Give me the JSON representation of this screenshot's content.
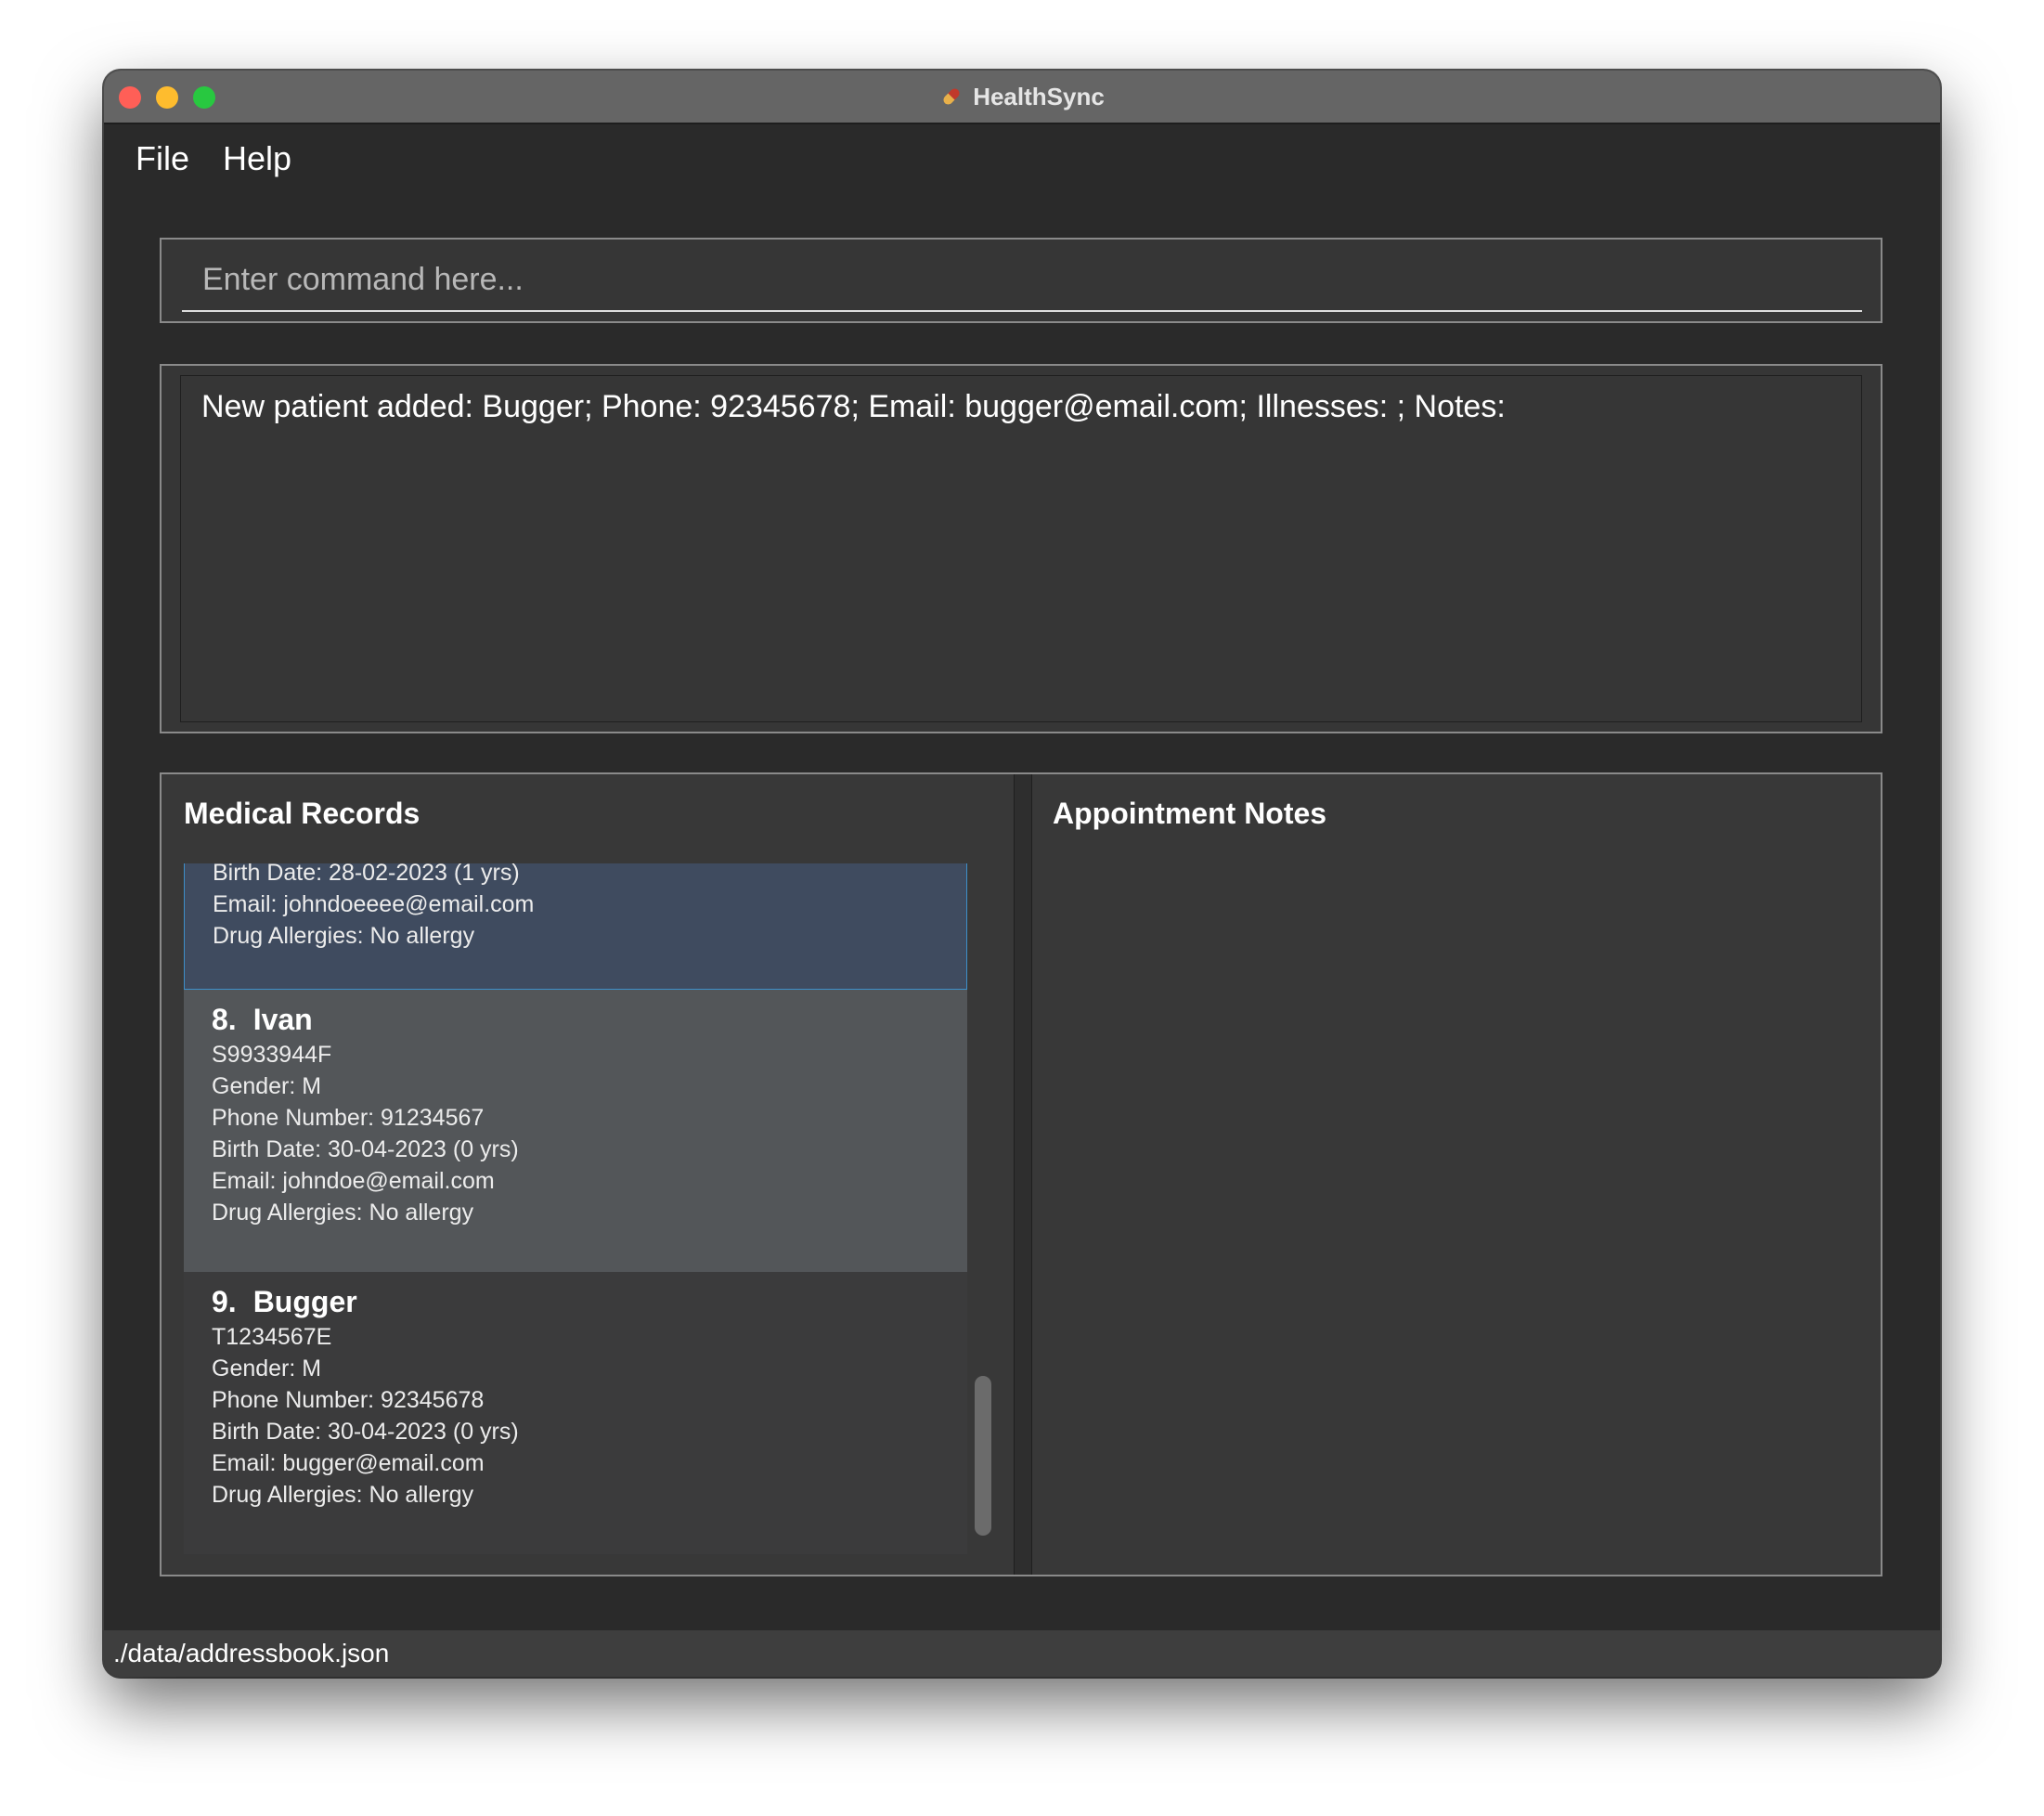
{
  "window": {
    "title": "HealthSync",
    "app_icon": "pill-icon"
  },
  "menu": {
    "file": "File",
    "help": "Help"
  },
  "command": {
    "placeholder": "Enter command here...",
    "value": ""
  },
  "result": {
    "message": "New patient added: Bugger; Phone: 92345678; Email: bugger@email.com; Illnesses: ; Notes:"
  },
  "records": {
    "title": "Medical Records",
    "partial_card": {
      "birth_date": "Birth Date: 28-02-2023 (1 yrs)",
      "email": "Email: johndoeeee@email.com",
      "allergies": "Drug Allergies: No allergy"
    },
    "cards": [
      {
        "index": "8.",
        "name": "Ivan",
        "nric": "S9933944F",
        "gender": "Gender: M",
        "phone": "Phone Number: 91234567",
        "birth_date": "Birth Date: 30-04-2023 (0 yrs)",
        "email": "Email: johndoe@email.com",
        "allergies": "Drug Allergies: No allergy"
      },
      {
        "index": "9.",
        "name": "Bugger",
        "nric": "T1234567E",
        "gender": "Gender: M",
        "phone": "Phone Number: 92345678",
        "birth_date": "Birth Date: 30-04-2023 (0 yrs)",
        "email": "Email: bugger@email.com",
        "allergies": "Drug Allergies: No allergy"
      }
    ]
  },
  "appointments": {
    "title": "Appointment Notes"
  },
  "status": {
    "file_path": "./data/addressbook.json"
  }
}
